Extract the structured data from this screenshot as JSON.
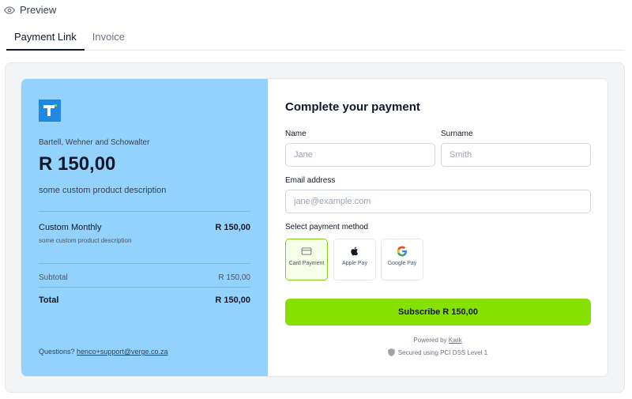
{
  "preview": {
    "title": "Preview"
  },
  "tabs": [
    {
      "label": "Payment Link",
      "active": true
    },
    {
      "label": "Invoice",
      "active": false
    }
  ],
  "summary": {
    "merchant": "Bartell, Wehner and Schowalter",
    "amount": "R 150,00",
    "description": "some custom product description",
    "item": {
      "name": "Custom Monthly",
      "description": "some custom product description",
      "price": "R 150,00"
    },
    "subtotal_label": "Subtotal",
    "subtotal_value": "R 150,00",
    "total_label": "Total",
    "total_value": "R 150,00",
    "questions_label": "Questions?",
    "support_email": "henco+support@verge.co.za",
    "bg_color": "#93d2fd"
  },
  "form": {
    "title": "Complete your payment",
    "name_label": "Name",
    "name_placeholder": "Jane",
    "surname_label": "Surname",
    "surname_placeholder": "Smith",
    "email_label": "Email address",
    "email_placeholder": "jane@example.com",
    "payment_method_label": "Select payment method",
    "methods": [
      {
        "label": "Card Payment",
        "icon": "credit-card-icon",
        "selected": true
      },
      {
        "label": "Apple Pay",
        "icon": "apple-icon",
        "selected": false
      },
      {
        "label": "Google Pay",
        "icon": "google-icon",
        "selected": false
      }
    ],
    "submit_label": "Subscribe R 150,00",
    "powered_by": "Powered by",
    "powered_brand": "Kwik",
    "secured_text": "Secured using PCI DSS Level 1",
    "accent_color": "#86e000"
  }
}
